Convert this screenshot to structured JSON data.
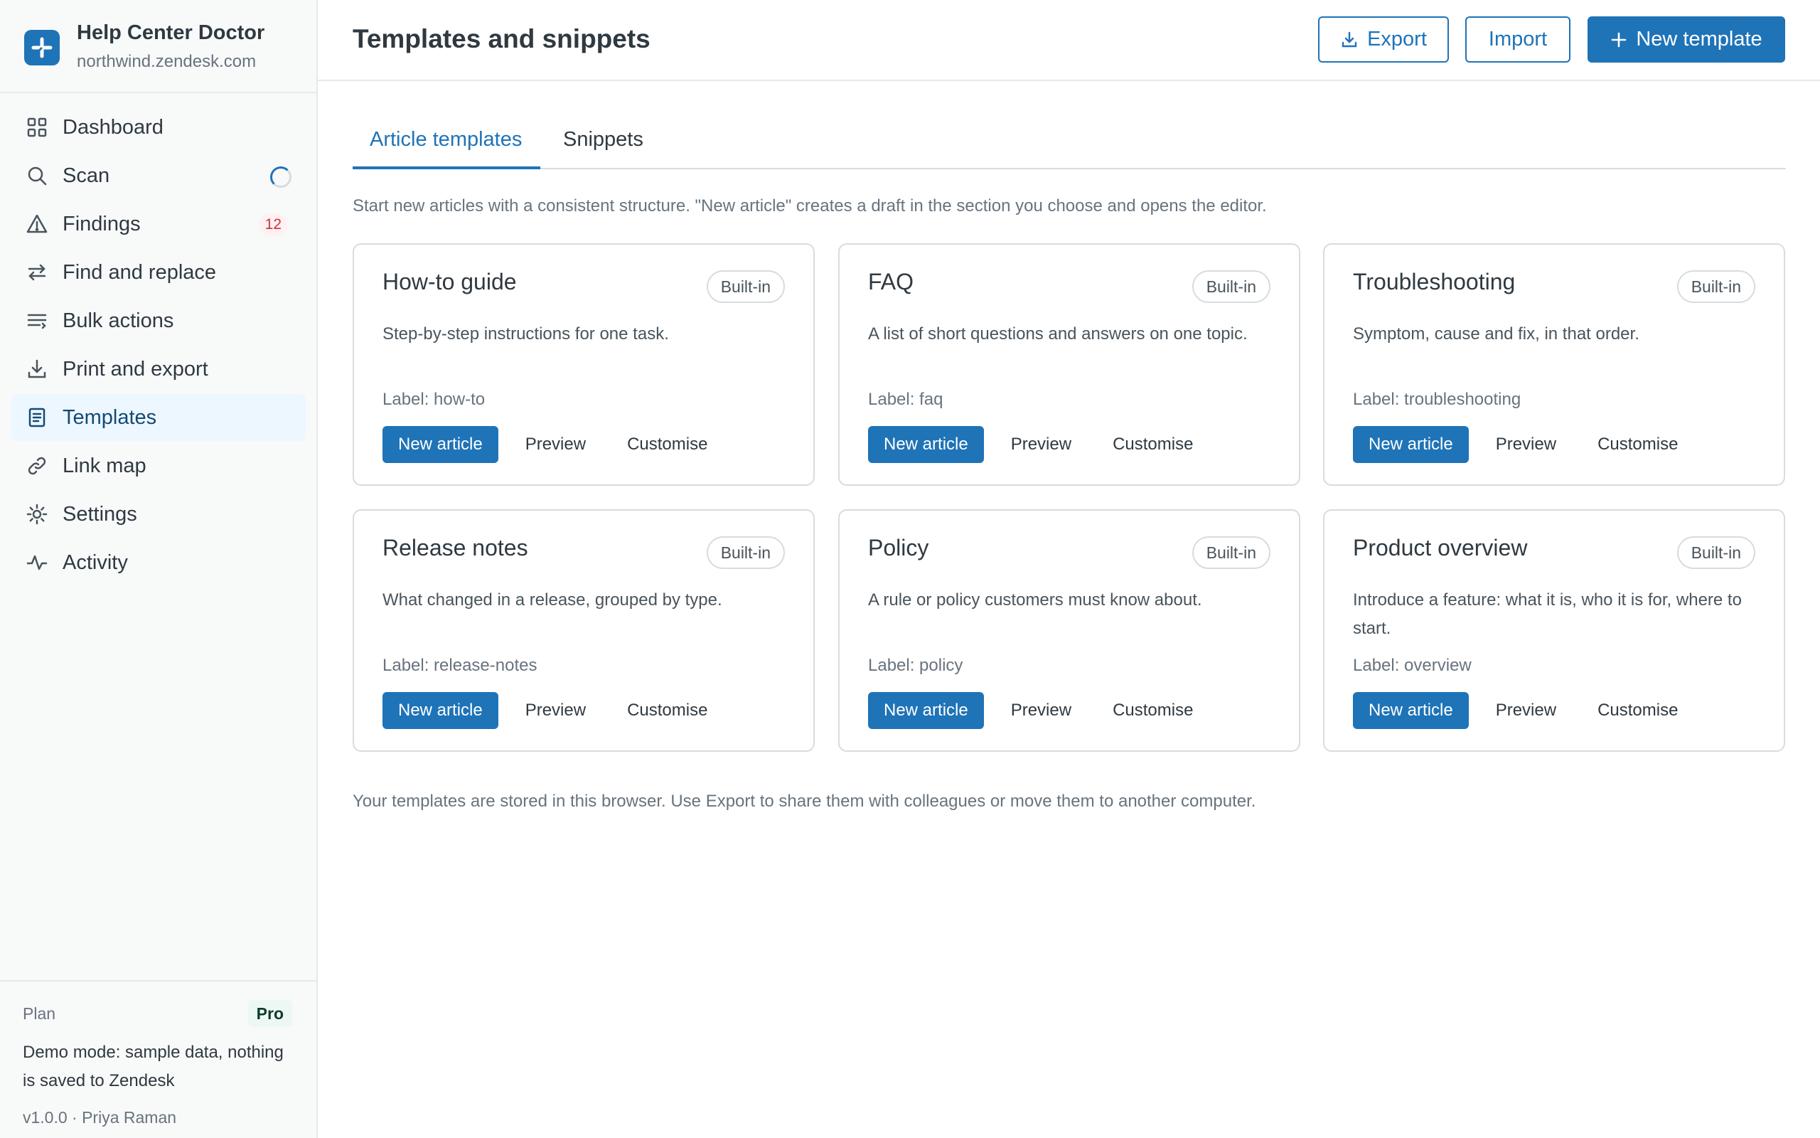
{
  "app": {
    "name": "Help Center Doctor",
    "host": "northwind.zendesk.com",
    "brand_color": "#1f73b7"
  },
  "sidebar": {
    "items": [
      {
        "label": "Dashboard",
        "icon": "dashboard-grid-icon"
      },
      {
        "label": "Scan",
        "icon": "search-icon",
        "status": "spinner"
      },
      {
        "label": "Findings",
        "icon": "warning-triangle-icon",
        "badge": "12"
      },
      {
        "label": "Find and replace",
        "icon": "swap-arrows-icon"
      },
      {
        "label": "Bulk actions",
        "icon": "list-lines-icon"
      },
      {
        "label": "Print and export",
        "icon": "download-icon"
      },
      {
        "label": "Templates",
        "icon": "document-icon",
        "active": true
      },
      {
        "label": "Link map",
        "icon": "link-icon"
      },
      {
        "label": "Settings",
        "icon": "gear-icon"
      },
      {
        "label": "Activity",
        "icon": "activity-pulse-icon"
      }
    ],
    "footer": {
      "plan_label": "Plan",
      "plan_value": "Pro",
      "demo_text": "Demo mode: sample data, nothing is saved to Zendesk",
      "version": "v1.0.0 · Priya Raman"
    }
  },
  "header": {
    "title": "Templates and snippets",
    "export_label": "Export",
    "import_label": "Import",
    "new_template_label": "New template"
  },
  "tabs": [
    {
      "label": "Article templates",
      "active": true
    },
    {
      "label": "Snippets",
      "active": false
    }
  ],
  "intro": "Start new articles with a consistent structure. \"New article\" creates a draft in the section you choose and opens the editor.",
  "cards": [
    {
      "title": "How-to guide",
      "badge": "Built-in",
      "description": "Step-by-step instructions for one task.",
      "label": "Label: how-to",
      "new_label": "New article",
      "preview_label": "Preview",
      "customise_label": "Customise"
    },
    {
      "title": "FAQ",
      "badge": "Built-in",
      "description": "A list of short questions and answers on one topic.",
      "label": "Label: faq",
      "new_label": "New article",
      "preview_label": "Preview",
      "customise_label": "Customise"
    },
    {
      "title": "Troubleshooting",
      "badge": "Built-in",
      "description": "Symptom, cause and fix, in that order.",
      "label": "Label: troubleshooting",
      "new_label": "New article",
      "preview_label": "Preview",
      "customise_label": "Customise"
    },
    {
      "title": "Release notes",
      "badge": "Built-in",
      "description": "What changed in a release, grouped by type.",
      "label": "Label: release-notes",
      "new_label": "New article",
      "preview_label": "Preview",
      "customise_label": "Customise"
    },
    {
      "title": "Policy",
      "badge": "Built-in",
      "description": "A rule or policy customers must know about.",
      "label": "Label: policy",
      "new_label": "New article",
      "preview_label": "Preview",
      "customise_label": "Customise"
    },
    {
      "title": "Product overview",
      "badge": "Built-in",
      "description": "Introduce a feature: what it is, who it is for, where to start.",
      "label": "Label: overview",
      "new_label": "New article",
      "preview_label": "Preview",
      "customise_label": "Customise"
    }
  ],
  "footer_note": "Your templates are stored in this browser. Use Export to share them with colleagues or move them to another computer."
}
